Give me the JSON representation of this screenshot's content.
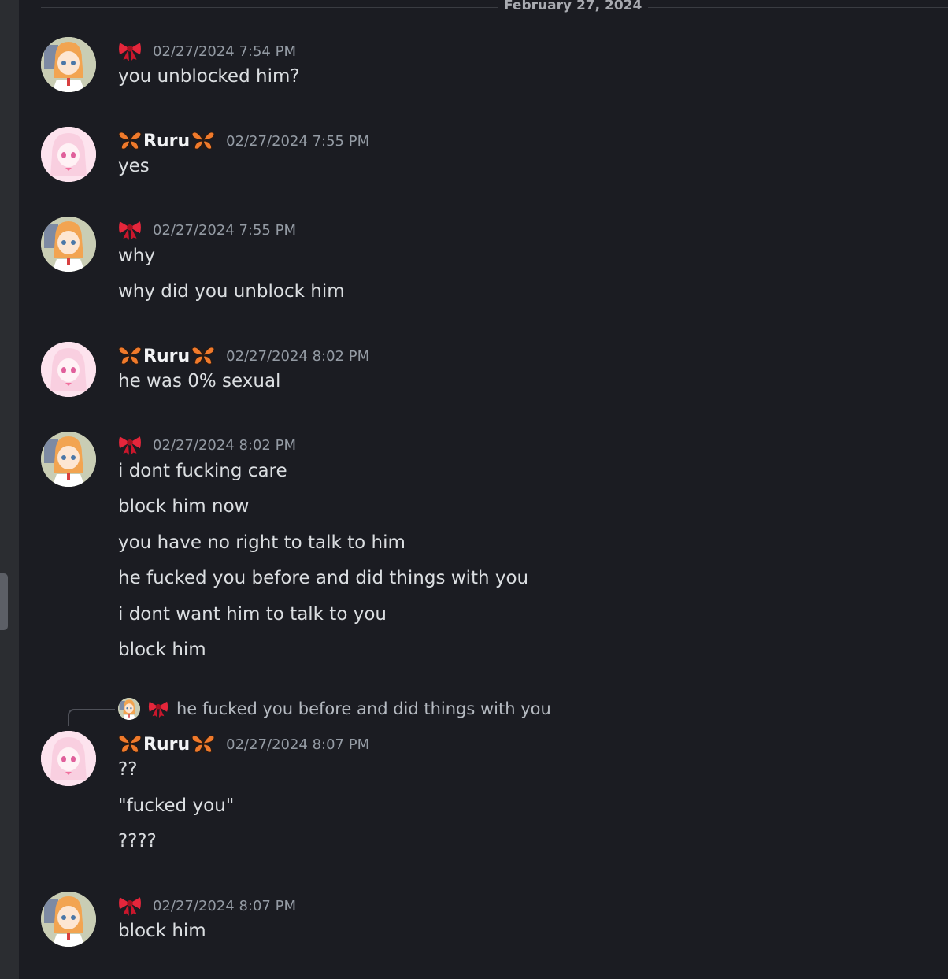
{
  "chat": {
    "date_divider": "February 27, 2024",
    "users": {
      "a": {
        "name": "",
        "badge_icon": "red-bow-icon"
      },
      "b": {
        "name": "Ruru",
        "badge_icon": "butterfly-icon"
      }
    },
    "messages": [
      {
        "user": "a",
        "timestamp": "02/27/2024 7:54 PM",
        "lines": [
          "you unblocked him?"
        ]
      },
      {
        "user": "b",
        "timestamp": "02/27/2024 7:55 PM",
        "lines": [
          "yes"
        ]
      },
      {
        "user": "a",
        "timestamp": "02/27/2024 7:55 PM",
        "lines": [
          "why",
          "why did you unblock him"
        ]
      },
      {
        "user": "b",
        "timestamp": "02/27/2024 8:02 PM",
        "lines": [
          "he was 0% sexual"
        ]
      },
      {
        "user": "a",
        "timestamp": "02/27/2024 8:02 PM",
        "lines": [
          "i dont fucking care",
          "block him now",
          "you have no right to talk to him",
          "he fucked you before and did things with you",
          "i dont want him to talk to you",
          "block him"
        ]
      },
      {
        "user": "b",
        "timestamp": "02/27/2024 8:07 PM",
        "reply": {
          "user": "a",
          "text": "he fucked you before and did things with you"
        },
        "lines": [
          "??",
          "\"fucked you\"",
          "????"
        ]
      },
      {
        "user": "a",
        "timestamp": "02/27/2024 8:07 PM",
        "lines": [
          "block him"
        ]
      }
    ]
  }
}
